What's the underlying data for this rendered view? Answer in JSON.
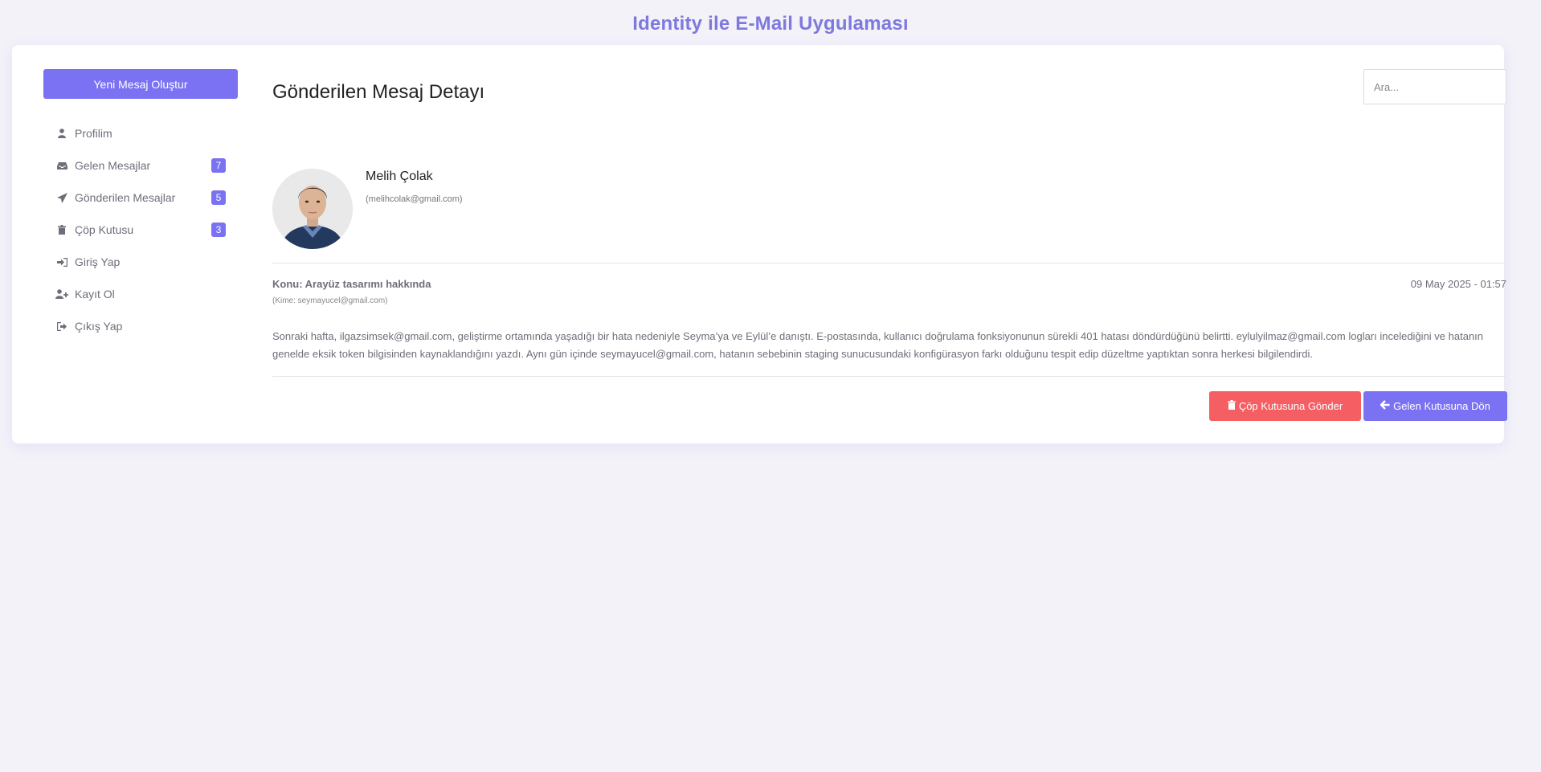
{
  "app": {
    "title": "Identity ile E-Mail Uygulaması"
  },
  "sidebar": {
    "compose_label": "Yeni Mesaj Oluştur",
    "items": [
      {
        "label": "Profilim",
        "icon": "user-icon"
      },
      {
        "label": "Gelen Mesajlar",
        "icon": "inbox-icon",
        "badge": "7"
      },
      {
        "label": "Gönderilen Mesajlar",
        "icon": "paper-plane-icon",
        "badge": "5"
      },
      {
        "label": "Çöp Kutusu",
        "icon": "trash-icon",
        "badge": "3"
      },
      {
        "label": "Giriş Yap",
        "icon": "sign-in-icon"
      },
      {
        "label": "Kayıt Ol",
        "icon": "user-plus-icon"
      },
      {
        "label": "Çıkış Yap",
        "icon": "sign-out-icon"
      }
    ]
  },
  "main": {
    "page_title": "Gönderilen Mesaj Detayı",
    "search_placeholder": "Ara...",
    "sender": {
      "name": "Melih Çolak",
      "email": "(melihcolak@gmail.com)"
    },
    "message": {
      "subject": "Konu: Arayüz tasarımı hakkında",
      "recipient": "(Kime: seymayucel@gmail.com)",
      "date": "09 May 2025 - 01:57",
      "body": "Sonraki hafta, ilgazsimsek@gmail.com, geliştirme ortamında yaşadığı bir hata nedeniyle Seyma’ya ve Eylül’e danıştı. E-postasında, kullanıcı doğrulama fonksiyonunun sürekli 401 hatası döndürdüğünü belirtti. eylulyilmaz@gmail.com logları incelediğini ve hatanın genelde eksik token bilgisinden kaynaklandığını yazdı. Aynı gün içinde seymayucel@gmail.com, hatanın sebebinin staging sunucusundaki konfigürasyon farkı olduğunu tespit edip düzeltme yaptıktan sonra herkesi bilgilendirdi."
    },
    "actions": {
      "trash_label": "Çöp Kutusuna Gönder",
      "back_label": "Gelen Kutusuna Dön"
    }
  },
  "colors": {
    "accent": "#7a72f2",
    "danger": "#f55f63",
    "title": "#7f78dd"
  }
}
